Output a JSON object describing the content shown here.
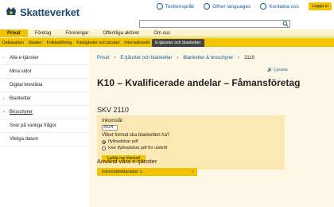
{
  "header": {
    "logo": "Skatteverket",
    "links": [
      "Teckenspråk",
      "Other languages",
      "Kontakta oss"
    ],
    "login": "Logga in",
    "search_placeholder": ""
  },
  "topnav": [
    "Privat",
    "Företag",
    "Föreningar",
    "Offentliga aktörer",
    "Om oss"
  ],
  "subnav": [
    "Deklaration",
    "Skatter",
    "Folkbokföring",
    "Fastigheter och bostad",
    "Internationellt",
    "E-tjänster och blanketter"
  ],
  "sidebar": [
    {
      "label": "Alla e-tjänster",
      "arrow": "‹"
    },
    {
      "label": "Mina sidor",
      "arrow": ""
    },
    {
      "label": "Digital brevlåda",
      "arrow": ""
    },
    {
      "label": "Blanketter",
      "arrow": "‹"
    },
    {
      "label": "Broschyrer",
      "arrow": "•"
    },
    {
      "label": "Svar på vanliga frågor",
      "arrow": ""
    },
    {
      "label": "Viktiga datum",
      "arrow": ""
    }
  ],
  "breadcrumb": [
    "Privat",
    "›",
    "E-tjänster och blanketter",
    "›",
    "Blanketter & broschyrer",
    "›",
    "2110"
  ],
  "listen": "Lyssna",
  "page_title": "K10 – Kvalificerade andelar – Fåmansföretag",
  "form_code": "SKV 2110",
  "form": {
    "year_label": "Inkomstår",
    "year_value": "2024",
    "question": "Vilket format ska blanketten ha?",
    "options": [
      "Ifyllnadsbar pdf",
      "Icke ifyllnadsbar pdf för utskrift"
    ],
    "selected": 0,
    "download": "Ladda ner blankett"
  },
  "eservices": {
    "title": "Använd våra e-tjänster",
    "item": "Inkomstdeklaration 1",
    "chevron": "›"
  },
  "colors": {
    "accent": "#f2c400",
    "accent_light": "#fef4cc",
    "panel": "#fdf7e6",
    "link": "#1a5a9a"
  }
}
